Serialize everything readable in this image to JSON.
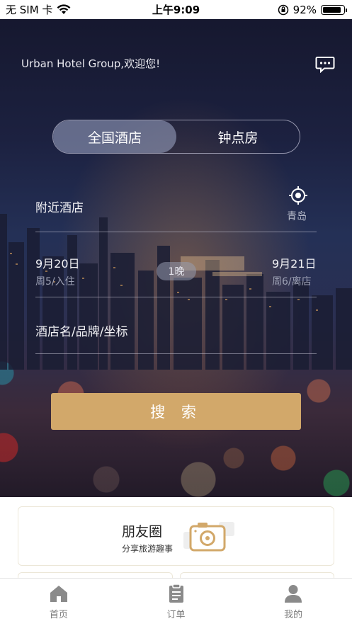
{
  "status_bar": {
    "carrier": "无 SIM 卡",
    "time": "上午9:09",
    "battery": "92%",
    "battery_level": 0.92
  },
  "header": {
    "welcome": "Urban Hotel Group,欢迎您!",
    "message_icon": "message-icon"
  },
  "booking_tabs": [
    {
      "label": "全国酒店",
      "active": true
    },
    {
      "label": "钟点房",
      "active": false
    }
  ],
  "location": {
    "label": "附近酒店",
    "city": "青岛",
    "icon": "locate-icon"
  },
  "dates": {
    "checkin": "9月20日",
    "checkin_sub": "周5/入住",
    "nights": "1晚",
    "checkout": "9月21日",
    "checkout_sub": "周6/离店"
  },
  "search": {
    "placeholder": "酒店名/品牌/坐标",
    "button": "搜 索"
  },
  "cards": [
    {
      "title": "朋友圈",
      "subtitle": "分享旅游趣事",
      "icon": "camera-icon",
      "accent": "#d2a86a"
    }
  ],
  "tabbar": [
    {
      "label": "首页",
      "icon": "home-icon"
    },
    {
      "label": "订单",
      "icon": "orders-icon"
    },
    {
      "label": "我的",
      "icon": "profile-icon"
    }
  ],
  "colors": {
    "accent": "#d2a86a",
    "hero_dark": "#1c2140"
  }
}
